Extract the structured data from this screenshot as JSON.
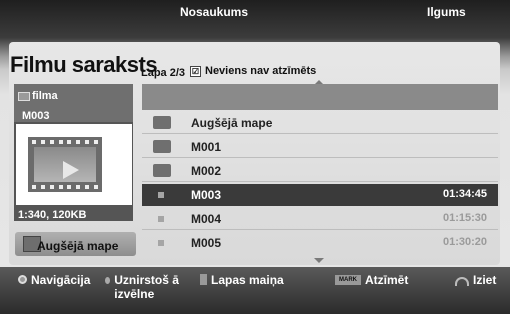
{
  "header": {
    "title": "Filmu saraksts",
    "page_info": "Lapa 2/3",
    "selection_status": "Neviens nav atzīmēts"
  },
  "preview": {
    "category_label": "filma",
    "file_code": "M003",
    "resolution_info": "1:340, 120KB",
    "up_folder_button": "Augšējā mape"
  },
  "table": {
    "col_name": "Nosaukums",
    "col_length": "Ilgums",
    "rows": [
      {
        "name": "Augšējā mape",
        "length": "",
        "type": "up-folder"
      },
      {
        "name": "M001",
        "length": "",
        "type": "folder"
      },
      {
        "name": "M002",
        "length": "",
        "type": "folder"
      },
      {
        "name": "M003",
        "length": "01:34:45",
        "type": "file",
        "selected": true
      },
      {
        "name": "M004",
        "length": "01:15:30",
        "type": "file"
      },
      {
        "name": "M005",
        "length": "01:30:20",
        "type": "file"
      }
    ]
  },
  "footer": {
    "nav": "Navigācija",
    "popup": "Uznirstoš ā izvēlne",
    "page_change": "Lapas maiņa",
    "mark_key": "MARK",
    "mark": "Atzīmēt",
    "exit": "Iziet"
  }
}
